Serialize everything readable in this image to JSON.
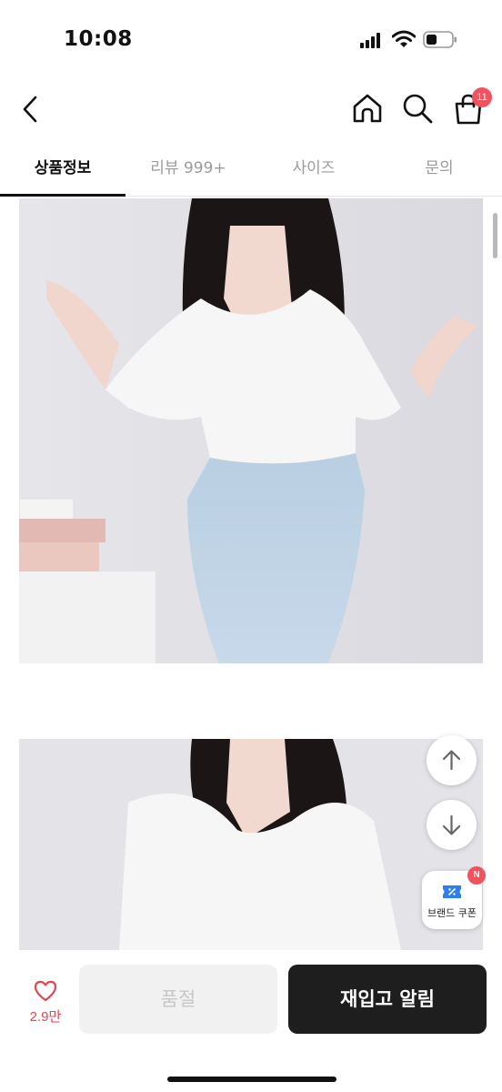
{
  "status_bar": {
    "time": "10:08"
  },
  "nav": {
    "cart_count": "11"
  },
  "tabs": [
    {
      "label": "상품정보",
      "active": true
    },
    {
      "label": "리뷰 999+",
      "active": false
    },
    {
      "label": "사이즈",
      "active": false
    },
    {
      "label": "문의",
      "active": false
    }
  ],
  "float": {
    "coupon_label": "브랜드 쿠폰",
    "coupon_badge": "N"
  },
  "bottom": {
    "like_count": "2.9만",
    "soldout_label": "품절",
    "restock_label": "재입고 알림"
  },
  "colors": {
    "accent_red": "#f0535d",
    "primary_dark": "#1e1e1e",
    "disabled_bg": "#f1f1f1"
  },
  "icons": [
    "back-arrow-icon",
    "home-icon",
    "search-icon",
    "shopping-bag-icon",
    "arrow-up-icon",
    "arrow-down-icon",
    "coupon-ticket-icon",
    "heart-icon"
  ]
}
